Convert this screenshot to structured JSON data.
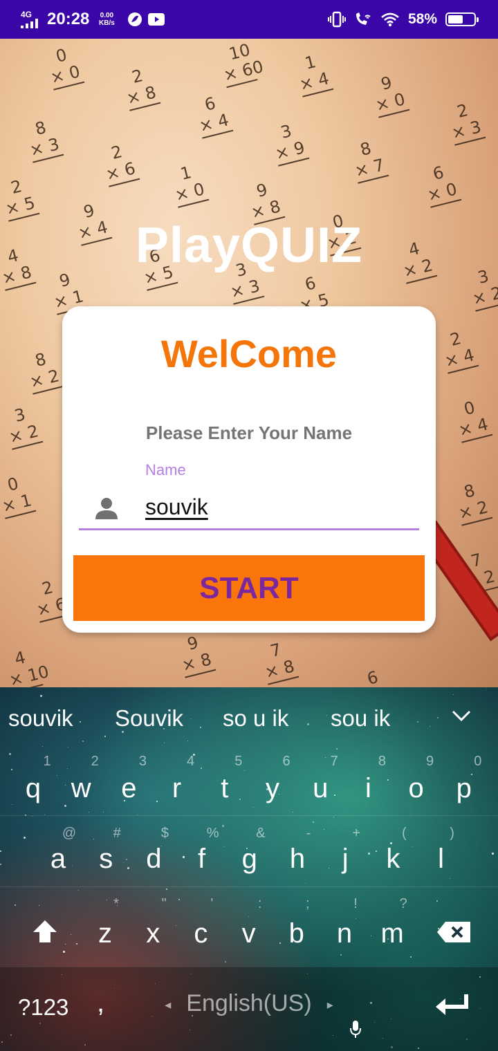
{
  "status_bar": {
    "network": "4G",
    "time": "20:28",
    "speed_value": "0.00",
    "speed_unit": "KB/s",
    "battery": "58%",
    "battery_level": 0.58
  },
  "app": {
    "title": "PlayQUIZ",
    "welcome": "WelCome",
    "prompt": "Please Enter Your Name",
    "name_label": "Name",
    "name_value": "souvik",
    "start_label": "START",
    "accent": "#fa760a",
    "field_accent": "#b47fe2",
    "button_text_color": "#7b27a0"
  },
  "keyboard": {
    "suggestions": [
      "souvik",
      "Souvik",
      "so u ik",
      "sou ik"
    ],
    "row1": [
      "q",
      "w",
      "e",
      "r",
      "t",
      "y",
      "u",
      "i",
      "o",
      "p"
    ],
    "row1_hints": [
      "1",
      "2",
      "3",
      "4",
      "5",
      "6",
      "7",
      "8",
      "9",
      "0"
    ],
    "row2": [
      "a",
      "s",
      "d",
      "f",
      "g",
      "h",
      "j",
      "k",
      "l"
    ],
    "row2_hints": [
      "@",
      "#",
      "$",
      "%",
      "&",
      "-",
      "+",
      "(",
      ")"
    ],
    "row3": [
      "z",
      "x",
      "c",
      "v",
      "b",
      "n",
      "m"
    ],
    "row3_hints": [
      "*",
      "\"",
      "'",
      ":",
      ";",
      "!",
      "?"
    ],
    "symbols_key": "?123",
    "comma_key": ",",
    "space_label": "English(US)",
    "icons": {
      "collapse": "chevron-down-icon",
      "shift": "shift-icon",
      "backspace": "backspace-icon",
      "mic": "mic-icon",
      "enter": "enter-icon"
    }
  }
}
